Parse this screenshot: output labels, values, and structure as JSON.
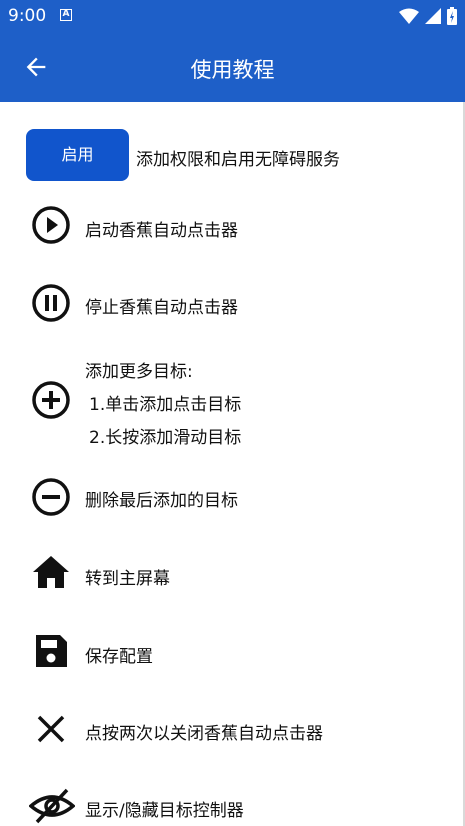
{
  "status_bar": {
    "time": "9:00",
    "badge": "A"
  },
  "app_bar": {
    "title": "使用教程"
  },
  "enable": {
    "button_label": "启用",
    "description": "添加权限和启用无障碍服务"
  },
  "items": [
    {
      "icon": "play-circle-icon",
      "label": "启动香蕉自动点击器"
    },
    {
      "icon": "pause-circle-icon",
      "label": "停止香蕉自动点击器"
    },
    {
      "icon": "add-circle-icon",
      "label": "添加更多目标:",
      "line2": "1.单击添加点击目标",
      "line3": "2.长按添加滑动目标"
    },
    {
      "icon": "remove-circle-icon",
      "label": "删除最后添加的目标"
    },
    {
      "icon": "home-icon",
      "label": "转到主屏幕"
    },
    {
      "icon": "save-icon",
      "label": "保存配置"
    },
    {
      "icon": "close-icon",
      "label": "点按两次以关闭香蕉自动点击器"
    },
    {
      "icon": "visibility-off-icon",
      "label": "显示/隐藏目标控制器"
    }
  ],
  "colors": {
    "primary": "#1e5fc8",
    "button": "#1155cc"
  }
}
